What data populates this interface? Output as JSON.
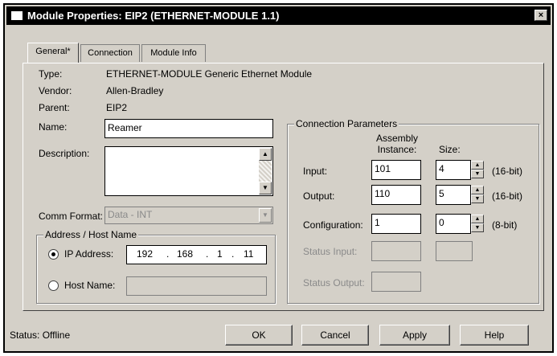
{
  "window": {
    "title": "Module Properties: EIP2 (ETHERNET-MODULE 1.1)",
    "close_glyph": "×"
  },
  "tabs": [
    {
      "label": "General*"
    },
    {
      "label": "Connection"
    },
    {
      "label": "Module Info"
    }
  ],
  "general": {
    "type_label": "Type:",
    "type_value": "ETHERNET-MODULE Generic Ethernet Module",
    "vendor_label": "Vendor:",
    "vendor_value": "Allen-Bradley",
    "parent_label": "Parent:",
    "parent_value": "EIP2",
    "name_label": "Name:",
    "name_value": "Reamer",
    "description_label": "Description:",
    "description_value": "",
    "comm_format_label": "Comm Format:",
    "comm_format_value": "Data - INT"
  },
  "address": {
    "group_title": "Address / Host Name",
    "ip_label": "IP Address:",
    "ip_selected": true,
    "ip_octets": [
      "192",
      "168",
      "1",
      "11"
    ],
    "host_label": "Host Name:",
    "host_value": ""
  },
  "connection_params": {
    "group_title": "Connection Parameters",
    "col_assembly": "Assembly Instance:",
    "col_size": "Size:",
    "rows": [
      {
        "label": "Input:",
        "instance": "101",
        "size": "4",
        "unit": "(16-bit)",
        "enabled": true
      },
      {
        "label": "Output:",
        "instance": "110",
        "size": "5",
        "unit": "(16-bit)",
        "enabled": true
      },
      {
        "label": "Configuration:",
        "instance": "1",
        "size": "0",
        "unit": "(8-bit)",
        "enabled": true
      },
      {
        "label": "Status Input:",
        "instance": "",
        "size": "",
        "enabled": false
      },
      {
        "label": "Status Output:",
        "instance": "",
        "enabled": false
      }
    ]
  },
  "footer": {
    "status": "Status:  Offline",
    "ok": "OK",
    "cancel": "Cancel",
    "apply": "Apply",
    "help": "Help"
  }
}
